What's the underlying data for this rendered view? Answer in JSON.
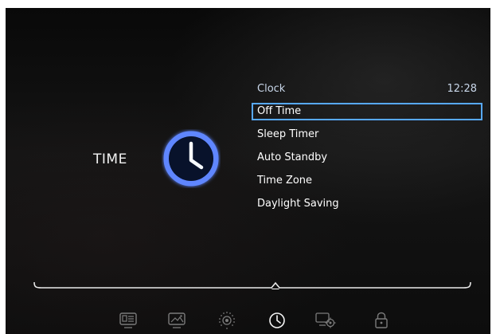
{
  "section": {
    "title": "TIME",
    "icon": "clock-icon"
  },
  "menu": {
    "title": "Clock",
    "time": "12:28",
    "items": [
      {
        "label": "Off Time",
        "selected": true
      },
      {
        "label": "Sleep Timer",
        "selected": false
      },
      {
        "label": "Auto Standby",
        "selected": false
      },
      {
        "label": "Time Zone",
        "selected": false
      },
      {
        "label": "Daylight Saving",
        "selected": false
      }
    ]
  },
  "nav": {
    "items": [
      {
        "icon": "channel-list-icon"
      },
      {
        "icon": "picture-icon"
      },
      {
        "icon": "sound-icon"
      },
      {
        "icon": "time-icon",
        "selected": true
      },
      {
        "icon": "settings-icon"
      },
      {
        "icon": "lock-icon"
      }
    ]
  },
  "colors": {
    "accent": "#57a9ff",
    "background": "#0b0b0b",
    "text": "#ffffff"
  }
}
